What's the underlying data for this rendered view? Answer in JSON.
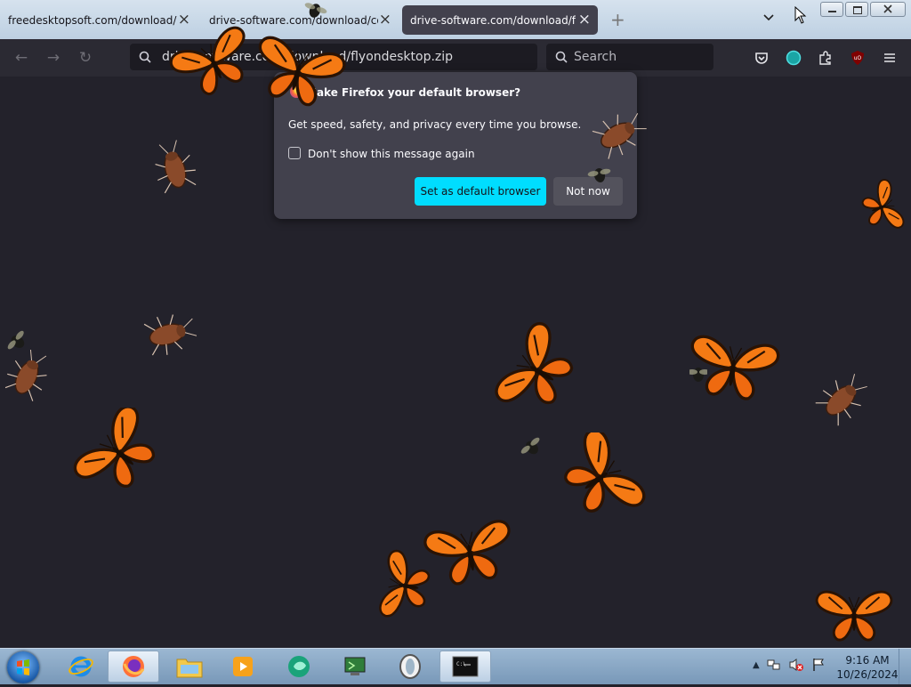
{
  "tabs": [
    {
      "title": "freedesktopsoft.com/download/bu",
      "active": false
    },
    {
      "title": "drive-software.com/download/coc",
      "active": false
    },
    {
      "title": "drive-software.com/download/flyo",
      "active": true
    }
  ],
  "toolbar": {
    "url": "drive-software.com/download/flyondesktop.zip",
    "search_placeholder": "Search"
  },
  "popup": {
    "heading": "Make Firefox your default browser?",
    "body": "Get speed, safety, and privacy every time you browse.",
    "checkbox_label": "Don't show this message again",
    "primary_button": "Set as default browser",
    "secondary_button": "Not now"
  },
  "taskbar": {
    "apps": [
      "internet-explorer",
      "firefox",
      "file-explorer",
      "media-player",
      "browser-app",
      "terminal-app",
      "opera",
      "command-prompt"
    ],
    "time": "9:16 AM",
    "date": "10/26/2024"
  },
  "colors": {
    "page_bg": "#23222b",
    "toolbar_bg": "#2b2a33",
    "popup_bg": "#42414d",
    "primary_button": "#00ddff",
    "butterfly": "#f57a14"
  }
}
